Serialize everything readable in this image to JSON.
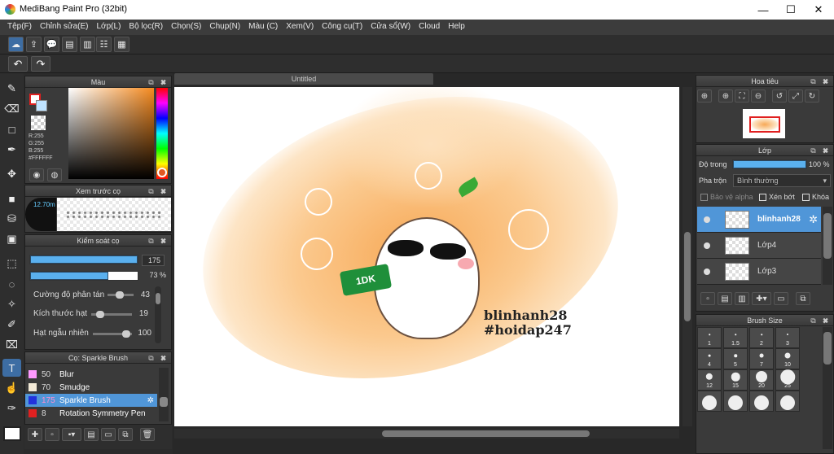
{
  "window": {
    "title": "MediBang Paint Pro (32bit)",
    "minimize": "—",
    "maximize": "☐",
    "close": "✕"
  },
  "menu": [
    "Tệp(F)",
    "Chỉnh sửa(E)",
    "Lớp(L)",
    "Bộ lọc(R)",
    "Chọn(S)",
    "Chụp(N)",
    "Màu (C)",
    "Xem(V)",
    "Công cụ(T)",
    "Cửa sổ(W)",
    "Cloud",
    "Help"
  ],
  "color_panel": {
    "title": "Màu",
    "rgb_r": "R:255",
    "rgb_g": "G:255",
    "rgb_b": "B:255",
    "hex": "#FFFFFF"
  },
  "preview_panel": {
    "title": "Xem trước cọ",
    "size": "12.70m"
  },
  "brush_control": {
    "title": "Kiểm soát cọ",
    "size_value": "175",
    "size_fraction": 1.0,
    "opacity_value": "73 %",
    "opacity_fraction": 0.73,
    "scatter_label": "Cường độ phân tán",
    "scatter_value": "43",
    "particle_label": "Kích thước hạt",
    "particle_value": "19",
    "random_label": "Hạt ngẫu nhiên",
    "random_value": "100"
  },
  "brush_list": {
    "title": "Cọ: Sparkle Brush",
    "items": [
      {
        "num": "50",
        "name": "Blur",
        "color": "#ff99ff"
      },
      {
        "num": "70",
        "name": "Smudge",
        "color": "#f3ead7"
      },
      {
        "num": "175",
        "name": "Sparkle Brush",
        "color": "#2233dd"
      },
      {
        "num": "8",
        "name": "Rotation Symmetry Pen",
        "color": "#e02020"
      }
    ]
  },
  "canvas": {
    "tab": "Untitled",
    "text1": "blinhanh28",
    "text2": "#hoidap247",
    "flag_text": "1DK"
  },
  "navigator": {
    "title": "Hoa tiêu"
  },
  "layers": {
    "title": "Lớp",
    "opacity_label": "Độ trong",
    "opacity_value": "100 %",
    "opacity_fraction": 1.0,
    "blend_label": "Pha trộn",
    "blend_value": "Bình thường",
    "protect_alpha": "Bảo vệ alpha",
    "clipping": "Xén bớt",
    "lock": "Khóa",
    "items": [
      {
        "name": "blinhanh28",
        "selected": true
      },
      {
        "name": "Lớp4",
        "selected": false
      },
      {
        "name": "Lớp3",
        "selected": false
      }
    ]
  },
  "brush_size": {
    "title": "Brush Size",
    "sizes": [
      "1",
      "1.5",
      "2",
      "3",
      "4",
      "5",
      "7",
      "10",
      "12",
      "15",
      "20",
      "25",
      "",
      "",
      "",
      ""
    ]
  }
}
